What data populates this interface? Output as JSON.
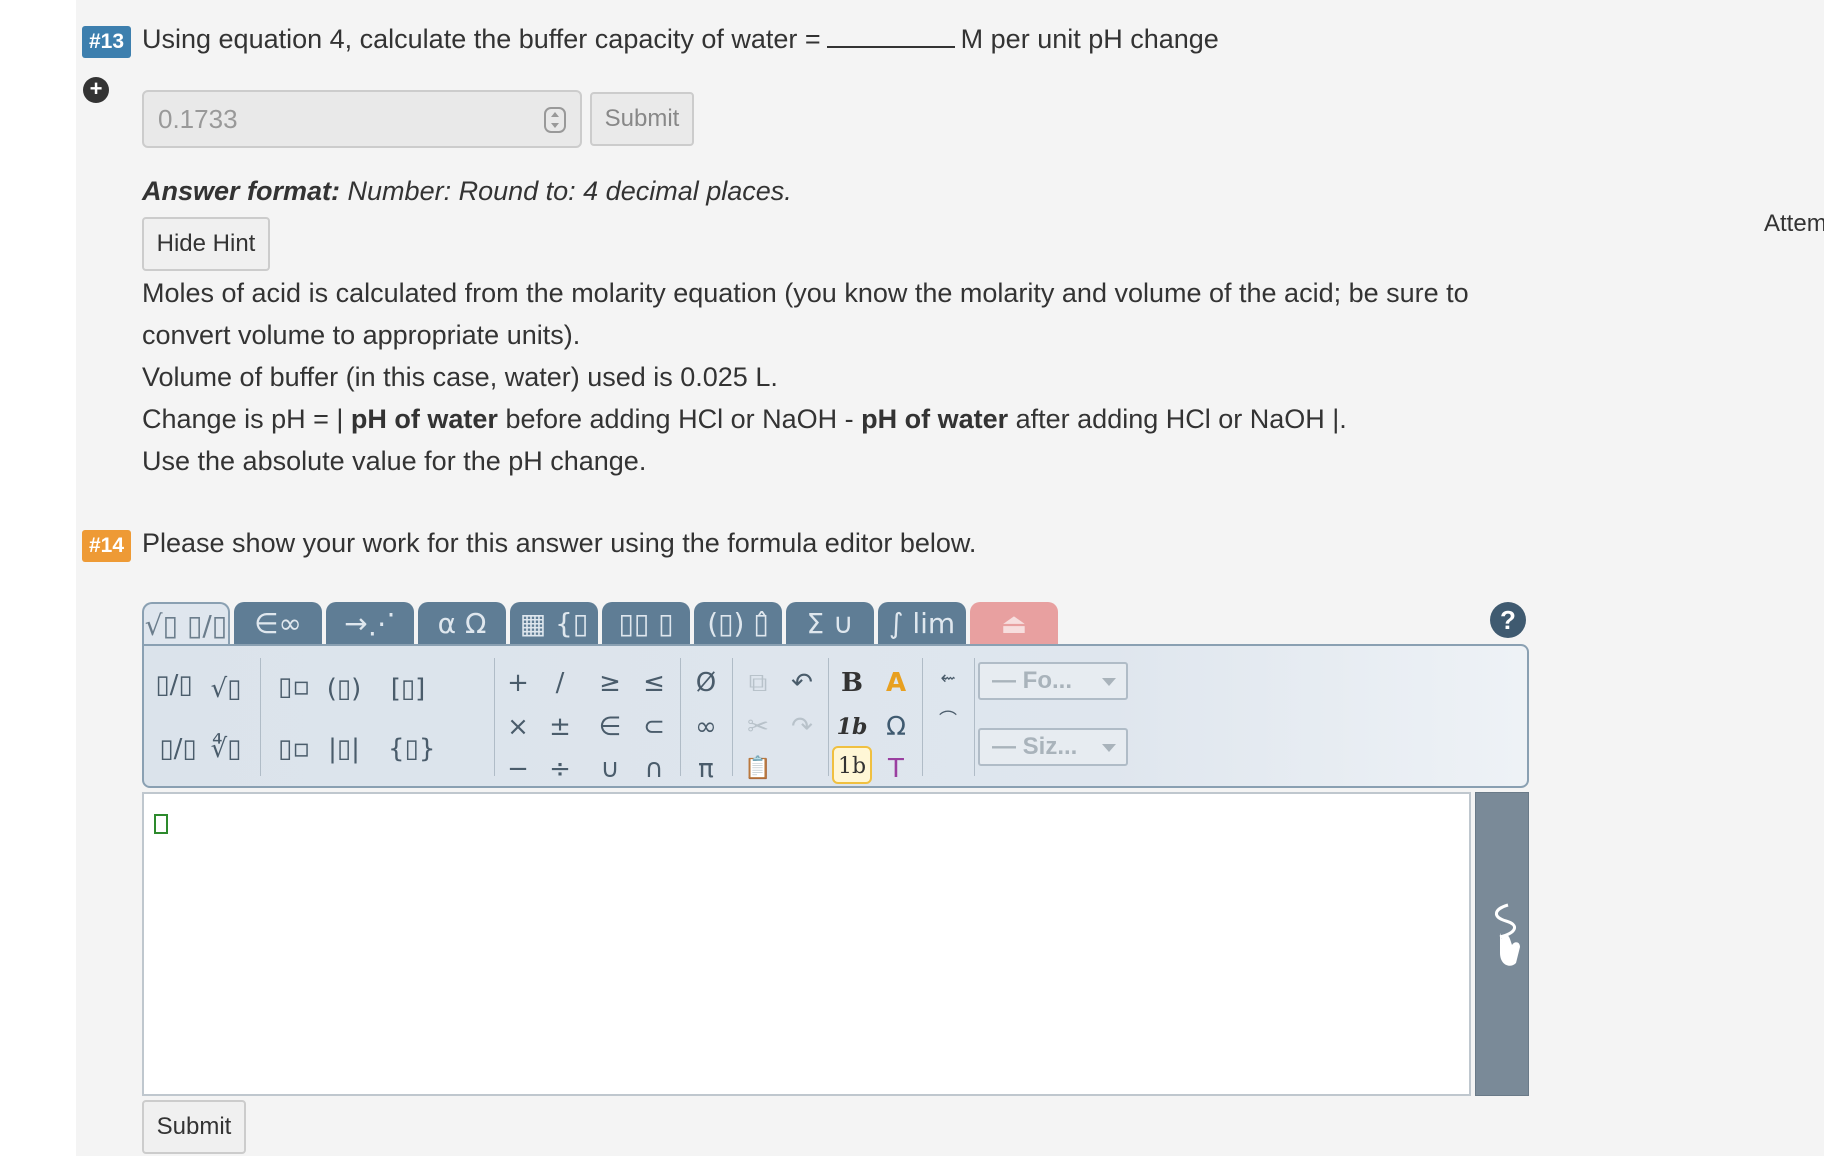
{
  "q13": {
    "badge": "#13",
    "badge_color": "#3d7fae",
    "text_before": "Using equation 4, calculate the buffer capacity of water =",
    "text_after": "M per unit pH change",
    "answer_value": "0.1733",
    "submit_label": "Submit",
    "answer_format_label": "Answer format:",
    "answer_format_value": "Number: Round to: 4 decimal places.",
    "hint_button_label": "Hide Hint",
    "hint": {
      "line1": "Moles of acid is calculated from the molarity equation (you know the molarity and volume of the acid; be sure to convert volume to appropriate units).",
      "line2": "Volume of buffer (in this case, water) used is 0.025 L.",
      "line3_a": "Change is pH = |",
      "line3_b": "pH of water",
      "line3_c": "before adding HCl or NaOH -",
      "line3_d": "pH of water",
      "line3_e": "after adding HCl or NaOH |.",
      "line4": "Use the absolute value for the pH change."
    }
  },
  "attempts_label": "Attem",
  "q14": {
    "badge": "#14",
    "badge_color": "#ee9a35",
    "text": "Please show your work for this answer using the formula editor below.",
    "submit_label": "Submit"
  },
  "editor": {
    "tabs": [
      "√▯ ▯/▯",
      "∈∞",
      "→⋰",
      "α Ω",
      "▦ {▯",
      "▯▯ ▯",
      "(▯) ▯̂",
      "Σ ∪",
      "∫ lim",
      "⏏"
    ],
    "help_label": "?",
    "font_dropdown": "— Fo...",
    "size_dropdown": "— Siz...",
    "buttons": {
      "frac": "▯/▯",
      "sqrt": "√▯",
      "sup": "▯▫",
      "paren": "(▯)",
      "bracket": "[▯]",
      "plus": "+",
      "slash": "/",
      "geq": "≥",
      "leq": "≤",
      "emptyset": "Ø",
      "slashfrac": "▯/▯",
      "nroot": "∜▯",
      "sub": "▯▫",
      "abs": "|▯|",
      "brace": "{▯}",
      "times": "×",
      "pm": "±",
      "in": "∈",
      "subset": "⊂",
      "infty": "∞",
      "minus": "−",
      "div": "÷",
      "cup": "∪",
      "cap": "∩",
      "pi": "π",
      "copy": "⧉",
      "undo": "↶",
      "bold": "B",
      "color": "A",
      "cut": "✂",
      "redo": "↷",
      "italic": "1b",
      "omega": "Ω",
      "paste": "📋",
      "roman": "1b",
      "text": "T"
    }
  }
}
